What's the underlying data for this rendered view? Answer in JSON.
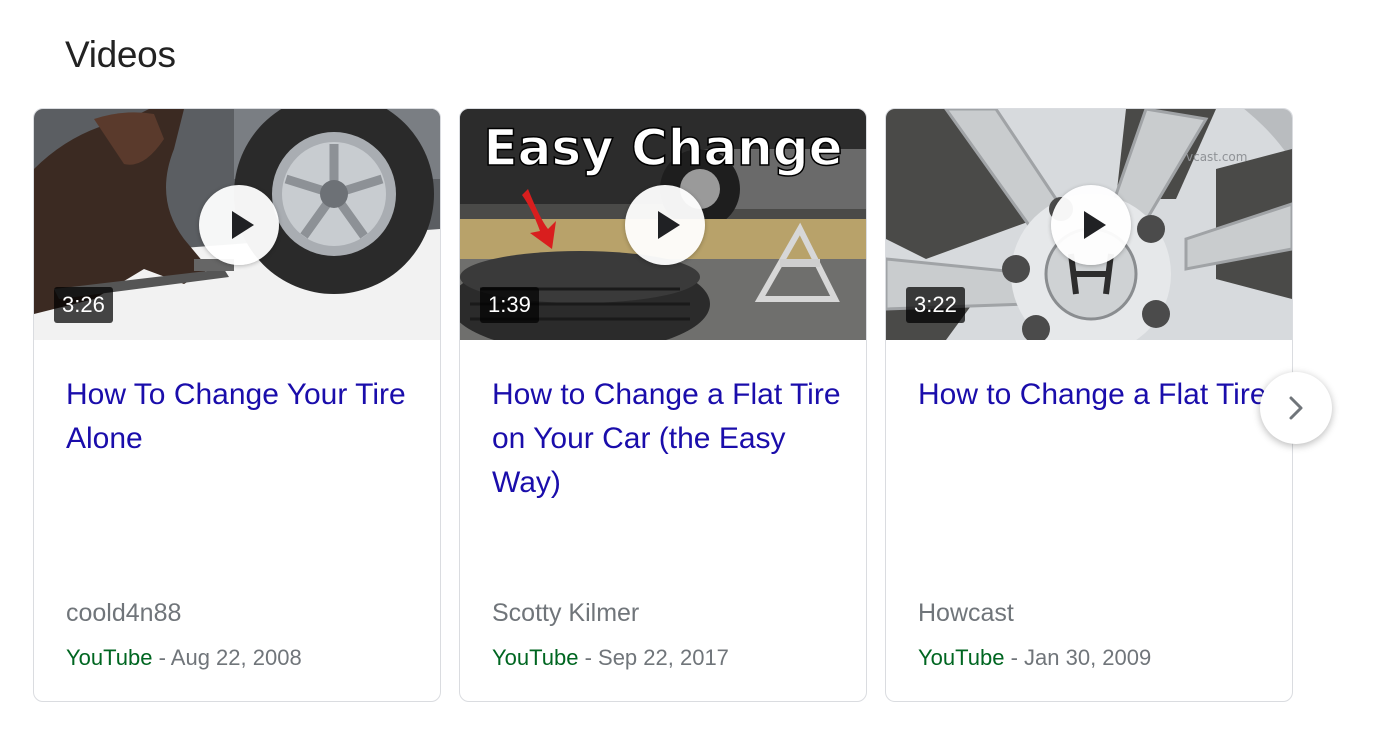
{
  "section": {
    "title": "Videos"
  },
  "videos": [
    {
      "title": "How To Change Your Tire Alone",
      "duration": "3:26",
      "channel": "coold4n88",
      "source": "YouTube",
      "separator": " - ",
      "date": "Aug 22, 2008"
    },
    {
      "title": "How to Change a Flat Tire on Your Car (the Easy Way)",
      "duration": "1:39",
      "channel": "Scotty Kilmer",
      "source": "YouTube",
      "separator": " - ",
      "date": "Sep 22, 2017",
      "thumbnail_caption": "Easy Change"
    },
    {
      "title": "How to Change a Flat Tire",
      "duration": "3:22",
      "channel": "Howcast",
      "source": "YouTube",
      "separator": " - ",
      "date": "Jan 30, 2009"
    }
  ],
  "icons": {
    "play": "play-icon",
    "next": "chevron-right-icon"
  },
  "colors": {
    "link": "#1a0dab",
    "source": "#006621",
    "meta": "#70757a"
  }
}
